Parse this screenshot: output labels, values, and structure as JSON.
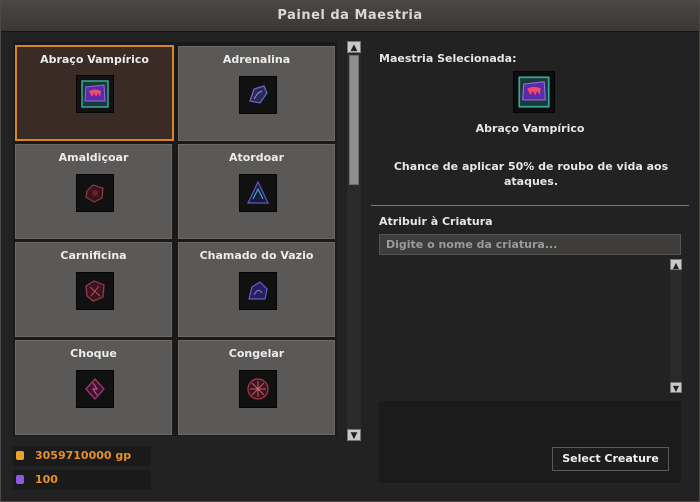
{
  "window": {
    "title": "Painel da Maestria"
  },
  "masteries": [
    {
      "name": "Abraço Vampírico",
      "icon": "vampire-fangs-icon",
      "color": "#5a2aa8",
      "selected": true
    },
    {
      "name": "Adrenalina",
      "icon": "adrenaline-icon",
      "color": "#4a3d86",
      "selected": false
    },
    {
      "name": "Amaldiçoar",
      "icon": "curse-icon",
      "color": "#7a2a3a",
      "selected": false
    },
    {
      "name": "Atordoar",
      "icon": "stun-icon",
      "color": "#3a3a8a",
      "selected": false
    },
    {
      "name": "Carnificina",
      "icon": "carnage-icon",
      "color": "#7a2a3a",
      "selected": false
    },
    {
      "name": "Chamado do Vazio",
      "icon": "void-call-icon",
      "color": "#4a3888",
      "selected": false
    },
    {
      "name": "Choque",
      "icon": "shock-icon",
      "color": "#8a2a5a",
      "selected": false
    },
    {
      "name": "Congelar",
      "icon": "freeze-icon",
      "color": "#7a2a3a",
      "selected": false
    }
  ],
  "resources": {
    "gold": "3059710000 gp",
    "points": "100"
  },
  "selection": {
    "label": "Maestria Selecionada:",
    "name": "Abraço Vampírico",
    "icon": "vampire-fangs-icon",
    "description": "Chance de aplicar 50% de roubo de vida aos ataques."
  },
  "assign": {
    "label": "Atribuir à Criatura",
    "placeholder": "Digite o nome da criatura...",
    "button": "Select Creature"
  }
}
